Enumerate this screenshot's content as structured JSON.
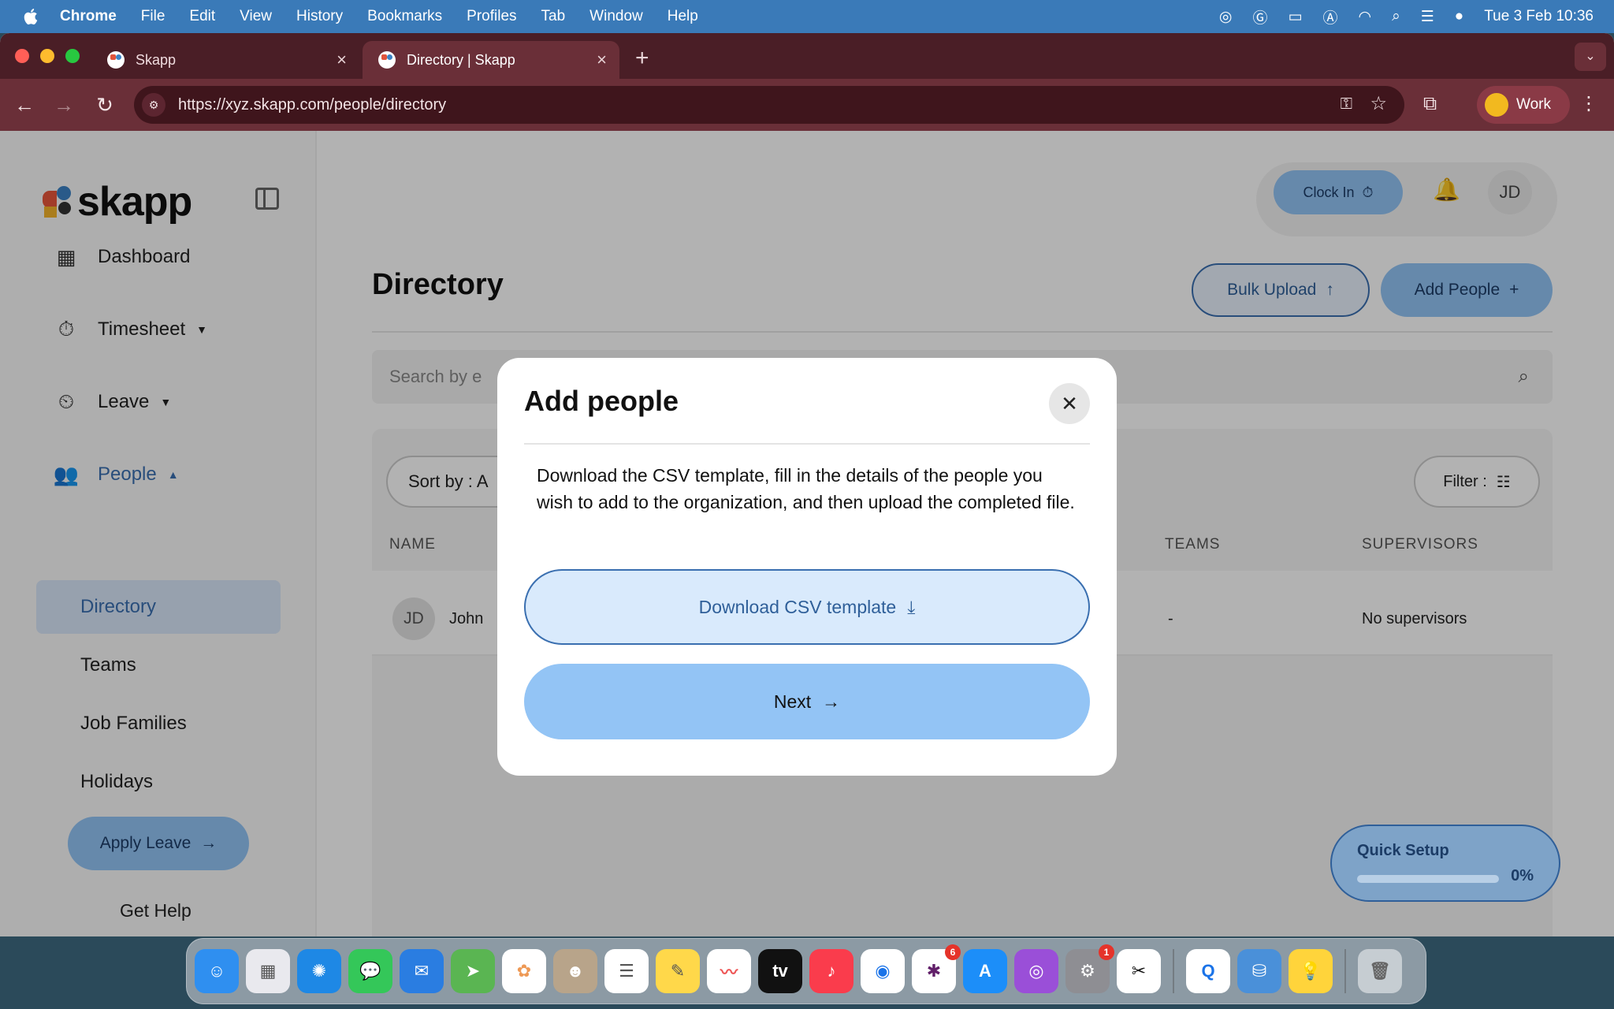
{
  "menubar": {
    "app_name": "Chrome",
    "items": [
      "File",
      "Edit",
      "View",
      "History",
      "Bookmarks",
      "Profiles",
      "Tab",
      "Window",
      "Help"
    ],
    "clock": "Tue 3 Feb  10:36"
  },
  "browser": {
    "tabs": [
      {
        "title": "Skapp"
      },
      {
        "title": "Directory | Skapp"
      }
    ],
    "url": "https://xyz.skapp.com/people/directory",
    "profile_label": "Work"
  },
  "sidebar": {
    "logo_text": "skapp",
    "nav": {
      "dashboard": "Dashboard",
      "timesheet": "Timesheet",
      "leave": "Leave",
      "people": "People"
    },
    "people_sub": {
      "directory": "Directory",
      "teams": "Teams",
      "job_families": "Job Families",
      "holidays": "Holidays"
    },
    "apply_leave": "Apply Leave",
    "get_help": "Get Help"
  },
  "header": {
    "clock_in": "Clock In",
    "avatar_initials": "JD"
  },
  "page": {
    "title": "Directory",
    "bulk_upload": "Bulk Upload",
    "add_people": "Add People",
    "search_placeholder": "Search by e",
    "sort_label": "Sort by : A",
    "filter_label": "Filter :",
    "columns": {
      "name": "NAME",
      "teams": "TEAMS",
      "supervisors": "SUPERVISORS"
    },
    "rows": [
      {
        "initials": "JD",
        "name": "John",
        "teams": "-",
        "supervisors": "No supervisors"
      }
    ]
  },
  "quick_setup": {
    "title": "Quick Setup",
    "percent": "0%",
    "progress": 0
  },
  "modal": {
    "title": "Add people",
    "body": "Download the CSV template, fill in the details of the people you wish to add to the organization, and then upload the completed file.",
    "download_button": "Download CSV template",
    "next_button": "Next"
  },
  "dock": {
    "badges": {
      "slack": "6",
      "settings": "1"
    }
  },
  "colors": {
    "accent": "#93c4f5",
    "accent_dark": "#3a6fb0",
    "browser_frame": "#6a2f38"
  }
}
